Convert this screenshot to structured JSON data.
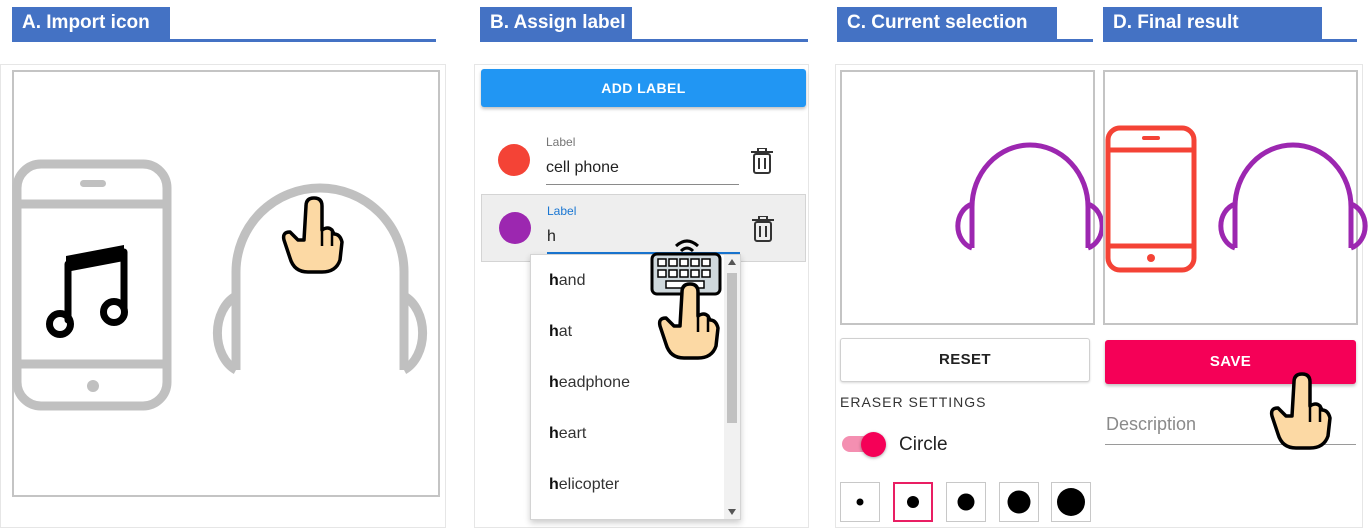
{
  "headers": {
    "import": "A. Import icon",
    "assign": "B. Assign label",
    "current": "C. Current selection",
    "final": "D. Final result"
  },
  "assign": {
    "add_label_button": "ADD LABEL",
    "labels": [
      {
        "field_label": "Label",
        "value": "cell phone",
        "color": "#f44336"
      },
      {
        "field_label": "Label",
        "value": "h",
        "color": "#9c27b0"
      }
    ],
    "suggestions": [
      {
        "match": "h",
        "rest": "and"
      },
      {
        "match": "h",
        "rest": "at"
      },
      {
        "match": "h",
        "rest": "eadphone"
      },
      {
        "match": "h",
        "rest": "eart"
      },
      {
        "match": "h",
        "rest": "elicopter"
      }
    ]
  },
  "current": {
    "reset_button": "RESET",
    "eraser_title": "ERASER SETTINGS",
    "shape_toggle_label": "Circle",
    "shape_toggle_on": true
  },
  "final": {
    "save_button": "SAVE",
    "description_placeholder": "Description"
  },
  "colors": {
    "header": "#4472c4",
    "add_label": "#2196f3",
    "save": "#f50057",
    "cell_phone_label": "#f44336",
    "headphone_label": "#9c27b0",
    "icon_gray": "#c0c0c0"
  }
}
